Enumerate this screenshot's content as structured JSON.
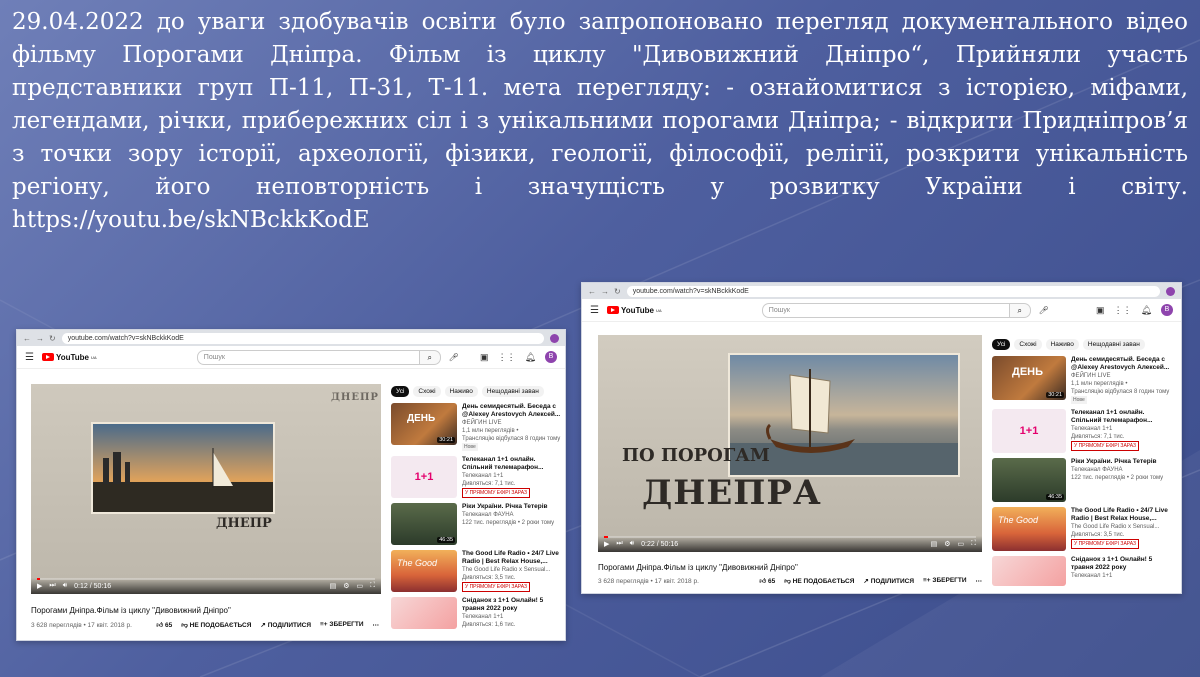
{
  "caption": "29.04.2022 до уваги  здобувачів освіти було запропоновано перегляд документального відео фільму Порогами Дніпра. Фільм із циклу \"Дивовижний Дніпро“, Прийняли участь представники груп П-11, П-31, Т-11. мета перегляду: -  ознайомитися з історією, міфами, легендами, річки, прибережних сіл і з унікальними порогами Дніпра; - відкрити Придніпров’я з точки зору історії, археології, фізики, геології, філософії, релігії, розкрити унікальність регіону, його неповторність і значущість у розвитку України і світу. https://youtu.be/skNBckkKodE",
  "browser": {
    "url": "youtube.com/watch?v=skNBckkKodE"
  },
  "youtube": {
    "logo": "YouTube",
    "logo_sup": "UA",
    "search_placeholder": "Пошук",
    "avatar_letter": "B",
    "notif_count": "9+"
  },
  "shot1": {
    "overlay_title": "ДНЕПР",
    "time": "0:12 / 50:16",
    "progress": 0.004
  },
  "shot2": {
    "overlay_line1": "ПО ПОРОГАМ",
    "overlay_line2": "ДНЕПРА",
    "time": "0:22 / 50:16",
    "progress": 0.007
  },
  "video": {
    "title": "Порогами Дніпра.Фільм із циклу \"Дивовижний Дніпро\"",
    "views": "3 628 переглядів • 17 квіт. 2018 р.",
    "likes": "65",
    "dislike": "НЕ ПОДОБАЄТЬСЯ",
    "share": "ПОДІЛИТИСЯ",
    "save": "ЗБЕРЕГТИ"
  },
  "chips": [
    "Усі",
    "Схожі",
    "Наживо",
    "Нещодавні заван"
  ],
  "recs": [
    {
      "title": "День семидесятый. Беседа с @Alexey Arestovych Алексей...",
      "channel": "ФЕЙГИН LIVE",
      "meta": "1,1 млн переглядів •",
      "meta2": "Трансляцію відбулася 8 годин тому",
      "badge": "Нове",
      "duration": "30:21",
      "thumb_text": "ДЕНЬ"
    },
    {
      "title": "Телеканал 1+1 онлайн. Спільний телемарафон...",
      "channel": "Телеканал 1+1",
      "meta": "Дивляться: 7,1 тис.",
      "live": "У ПРЯМОМУ ЕФІРІ ЗАРАЗ",
      "thumb_text": "1+1"
    },
    {
      "title": "Ріки України. Річка Тетерів",
      "channel": "Телеканал ФАУНА",
      "meta": "122 тис. переглядів • 2 роки тому",
      "duration": "46:35"
    },
    {
      "title": "The Good Life Radio • 24/7 Live Radio | Best Relax House,...",
      "channel": "The Good Life Radio x Sensual...",
      "meta": "Дивляться: 3,5 тис.",
      "live": "У ПРЯМОМУ ЕФІРІ ЗАРАЗ",
      "thumb_text": "The Good"
    },
    {
      "title": "Сніданок з 1+1 Онлайн! 5 травня 2022 року",
      "channel": "Телеканал 1+1",
      "meta": "Дивляться: 1,6 тис."
    }
  ]
}
